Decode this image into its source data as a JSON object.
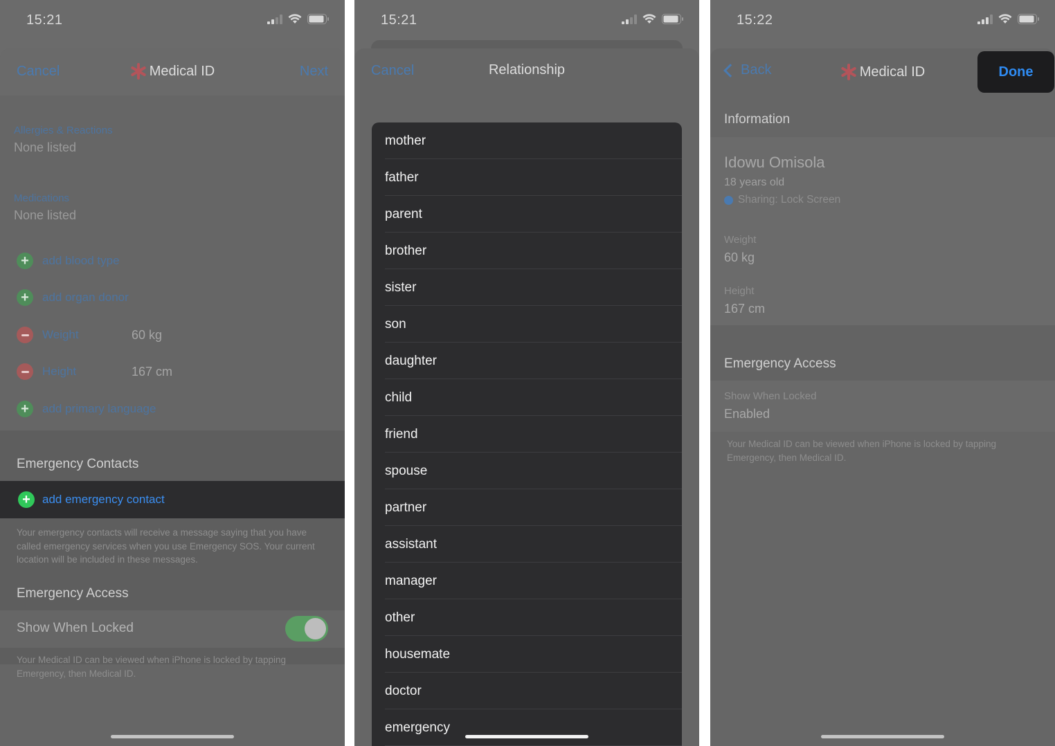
{
  "screen1": {
    "status": {
      "time": "15:21"
    },
    "nav": {
      "cancel": "Cancel",
      "title": "Medical ID",
      "next": "Next"
    },
    "allergies": {
      "label": "Allergies & Reactions",
      "value": "None listed"
    },
    "medications": {
      "label": "Medications",
      "value": "None listed"
    },
    "rows": {
      "blood_type": "add blood type",
      "organ_donor": "add organ donor",
      "weight_label": "Weight",
      "weight_value": "60 kg",
      "height_label": "Height",
      "height_value": "167 cm",
      "primary_language": "add primary language"
    },
    "emergency_contacts": {
      "header": "Emergency Contacts",
      "add": "add emergency contact",
      "footnote": "Your emergency contacts will receive a message saying that you have called emergency services when you use Emergency SOS. Your current location will be included in these messages."
    },
    "emergency_access": {
      "header": "Emergency Access",
      "show_when_locked": "Show When Locked",
      "toggle_on": true,
      "footnote": "Your Medical ID can be viewed when iPhone is locked by tapping Emergency, then Medical ID."
    }
  },
  "screen2": {
    "status": {
      "time": "15:21"
    },
    "nav": {
      "cancel": "Cancel",
      "title": "Relationship"
    },
    "relationships": [
      "mother",
      "father",
      "parent",
      "brother",
      "sister",
      "son",
      "daughter",
      "child",
      "friend",
      "spouse",
      "partner",
      "assistant",
      "manager",
      "other",
      "housemate",
      "doctor",
      "emergency"
    ]
  },
  "screen3": {
    "status": {
      "time": "15:22"
    },
    "nav": {
      "back": "Back",
      "title": "Medical ID",
      "done": "Done"
    },
    "information": {
      "header": "Information",
      "name": "Idowu Omisola",
      "age": "18 years old",
      "sharing": "Sharing: Lock Screen",
      "weight_label": "Weight",
      "weight_value": "60 kg",
      "height_label": "Height",
      "height_value": "167 cm"
    },
    "emergency_access": {
      "header": "Emergency Access",
      "show_label": "Show When Locked",
      "show_value": "Enabled",
      "footnote": "Your Medical ID can be viewed when iPhone is locked by tapping Emergency, then Medical ID."
    }
  },
  "colors": {
    "link": "#4a7ab0",
    "done": "#2f8bf2",
    "toggle_on": "#5a9e63",
    "star": "#b4545a"
  }
}
